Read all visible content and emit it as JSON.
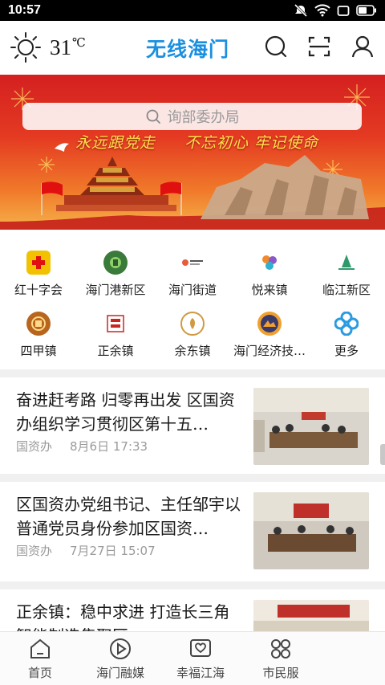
{
  "status_bar": {
    "time": "10:57"
  },
  "header": {
    "temperature": "31",
    "temp_unit": "℃",
    "app_title": "无线海门"
  },
  "banner": {
    "search_placeholder": "询部委办局",
    "slogan_left": "永远跟党走",
    "slogan_right": "不忘初心 牢记使命"
  },
  "quick_links": [
    {
      "label": "红十字会",
      "color": "#f2c200"
    },
    {
      "label": "海门港新区",
      "color": "#3a7a3a"
    },
    {
      "label": "海门街道",
      "color": "#e85c3a"
    },
    {
      "label": "悦来镇",
      "color": "#8a58c8"
    },
    {
      "label": "临江新区",
      "color": "#2e9a6a"
    },
    {
      "label": "四甲镇",
      "color": "#b8651e"
    },
    {
      "label": "正余镇",
      "color": "#c8261e"
    },
    {
      "label": "余东镇",
      "color": "#d09a40"
    },
    {
      "label": "海门经济技…",
      "color": "#5a6fa8"
    },
    {
      "label": "更多",
      "color": "#2b9be0"
    }
  ],
  "news": [
    {
      "title": "奋进赶考路 归零再出发 区国资办组织学习贯彻区第十五…",
      "source": "国资办",
      "date": "8月6日 17:33"
    },
    {
      "title": "区国资办党组书记、主任邹宇以普通党员身份参加区国资…",
      "source": "国资办",
      "date": "7月27日 15:07"
    },
    {
      "title": "正余镇：稳中求进 打造长三角智能制造集聚区",
      "source": "",
      "date": ""
    }
  ],
  "bottom_nav": [
    {
      "label": "首页"
    },
    {
      "label": "海门融媒"
    },
    {
      "label": "幸福江海"
    },
    {
      "label": "市民服"
    }
  ],
  "colors": {
    "brand": "#1a8fe0",
    "banner_red": "#d42020",
    "slogan_yellow": "#ffe14a"
  }
}
